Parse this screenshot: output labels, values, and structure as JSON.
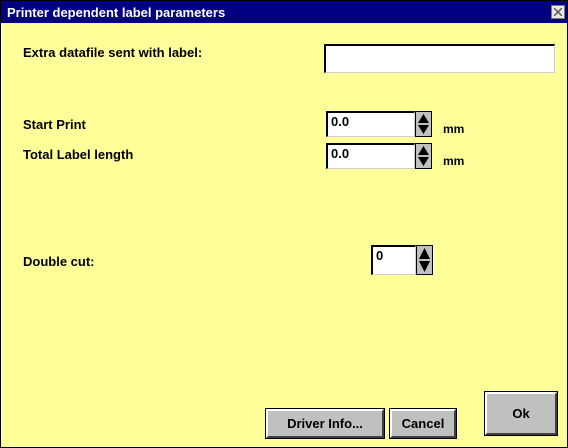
{
  "window": {
    "title": "Printer dependent label parameters"
  },
  "fields": {
    "extra_datafile": {
      "label": "Extra datafile sent with label:",
      "value": ""
    },
    "start_print": {
      "label": "Start Print",
      "value": "0.0",
      "unit": "mm"
    },
    "total_label_length": {
      "label": "Total Label length",
      "value": "0.0",
      "unit": "mm"
    },
    "double_cut": {
      "label": "Double cut:",
      "value": "0"
    }
  },
  "buttons": {
    "driver_info": "Driver Info...",
    "cancel": "Cancel",
    "ok": "Ok"
  },
  "icons": {
    "close": "close-icon",
    "spin": "spin-up-down-icon"
  },
  "colors": {
    "title_bar": "#000080",
    "dialog_background": "#ffff99",
    "button_face": "#c0c0c0"
  }
}
